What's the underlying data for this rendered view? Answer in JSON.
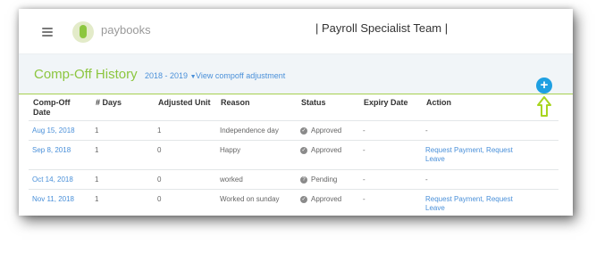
{
  "topbar": {
    "logo_text": "paybooks",
    "team_name": "| Payroll Specialist Team |"
  },
  "header": {
    "title": "Comp-Off History",
    "year_range": "2018 - 2019",
    "view_link": "View compoff adjustment"
  },
  "table": {
    "columns": [
      "Comp-Off Date",
      "# Days",
      "Adjusted Unit",
      "Reason",
      "Status",
      "Expiry Date",
      "Action"
    ],
    "rows": [
      {
        "date": "Aug 15, 2018",
        "days": "1",
        "adjusted": "1",
        "reason": "Independence day",
        "status": "Approved",
        "status_icon": "check-icon",
        "expiry": "-",
        "action": "-",
        "action_is_link": false
      },
      {
        "date": "Sep 8, 2018",
        "days": "1",
        "adjusted": "0",
        "reason": "Happy",
        "status": "Approved",
        "status_icon": "check-icon",
        "expiry": "-",
        "action": "Request Payment, Request Leave",
        "action_is_link": true
      },
      {
        "date": "Oct 14, 2018",
        "days": "1",
        "adjusted": "0",
        "reason": "worked",
        "status": "Pending",
        "status_icon": "question-icon",
        "expiry": "-",
        "action": "-",
        "action_is_link": false
      },
      {
        "date": "Nov 11, 2018",
        "days": "1",
        "adjusted": "0",
        "reason": "Worked on sunday",
        "status": "Approved",
        "status_icon": "check-icon",
        "expiry": "-",
        "action": "Request Payment, Request Leave",
        "action_is_link": true
      }
    ]
  },
  "add_button": {
    "symbol": "+"
  },
  "colors": {
    "brand_green": "#8cc63f",
    "link_blue": "#4a90d9",
    "add_button_blue": "#1fa0e2",
    "arrow_green": "#a8d520"
  }
}
